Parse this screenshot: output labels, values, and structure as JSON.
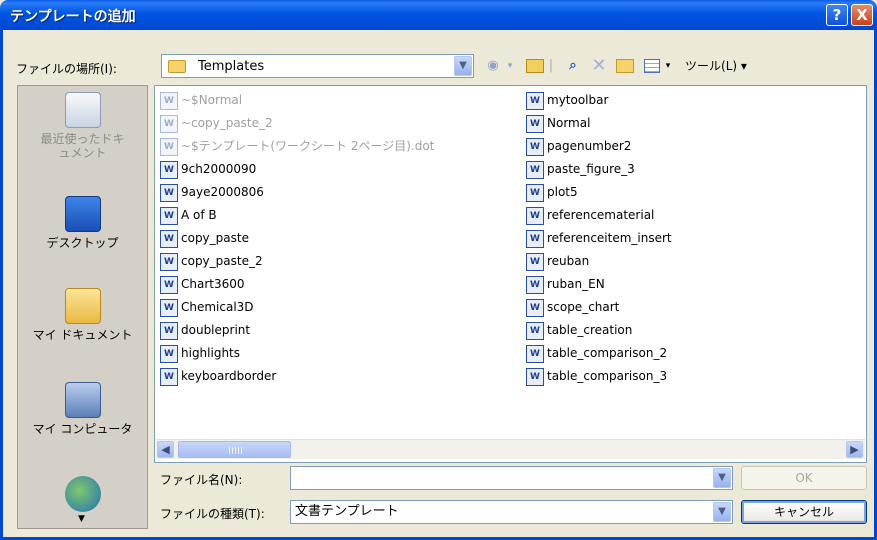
{
  "window": {
    "title": "テンプレートの追加",
    "help_btn": "?",
    "close_btn": "X"
  },
  "toolbar": {
    "lookin_label": "ファイルの場所(I):",
    "lookin_value": "Templates",
    "tools_label": "ツール(L)"
  },
  "places": [
    {
      "label": "最近使ったドキュメント"
    },
    {
      "label": "デスクトップ"
    },
    {
      "label": "マイ ドキュメント"
    },
    {
      "label": "マイ コンピュータ"
    }
  ],
  "files": {
    "col1": [
      "~$Normal",
      "~copy_paste_2",
      "~$テンプレート(ワークシート 2ページ目).dot",
      "9ch2000090",
      "9aye2000806",
      "A of B",
      "copy_paste",
      "copy_paste_2",
      "Chart3600",
      "Chemical3D",
      "doubleprint",
      "highlights",
      "keyboardborder"
    ],
    "col2": [
      "mytoolbar",
      "Normal",
      "pagenumber2",
      "paste_figure_3",
      "plot5",
      "referencematerial",
      "referenceitem_insert",
      "reuban",
      "ruban_EN",
      "scope_chart",
      "table_creation",
      "table_comparison_2",
      "table_comparison_3"
    ]
  },
  "form": {
    "filename_label": "ファイル名(N):",
    "filename_value": "",
    "filetype_label": "ファイルの種類(T):",
    "filetype_value": "文書テンプレート",
    "ok_label": "OK",
    "cancel_label": "キャンセル"
  },
  "colors": {
    "title_bar": "#0055E3",
    "dialog_bg": "#ECE9D8"
  }
}
